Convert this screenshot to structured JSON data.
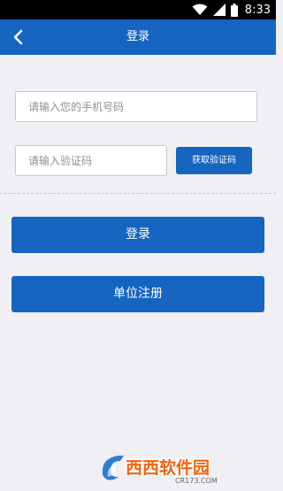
{
  "status_bar": {
    "time": "8:33",
    "icons": [
      "wifi-icon",
      "signal-icon",
      "battery-icon"
    ]
  },
  "nav": {
    "title": "登录",
    "back_icon": "chevron-left-icon"
  },
  "form": {
    "phone_placeholder": "请输入您的手机号码",
    "code_placeholder": "请输入验证码",
    "get_code_label": "获取验证码"
  },
  "actions": {
    "login_label": "登录",
    "register_label": "单位注册"
  },
  "watermark": {
    "brand": "西西软件园",
    "url": "CR173.COM"
  },
  "colors": {
    "primary": "#1565c0",
    "background": "#efeff4",
    "status_bar": "#000000"
  }
}
